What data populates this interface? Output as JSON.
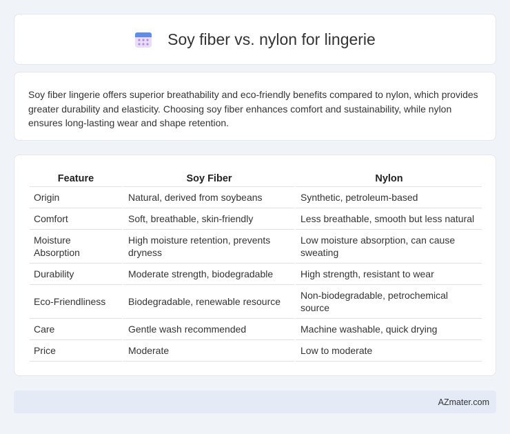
{
  "header": {
    "title": "Soy fiber vs. nylon for lingerie",
    "icon": "calendar-icon",
    "icon_colors": {
      "top": "#5b8def",
      "body": "#e9ddf7",
      "dots": "#b48cde"
    }
  },
  "intro": {
    "text": "Soy fiber lingerie offers superior breathability and eco-friendly benefits compared to nylon, which provides greater durability and elasticity. Choosing soy fiber enhances comfort and sustainability, while nylon ensures long-lasting wear and shape retention."
  },
  "table": {
    "headers": [
      "Feature",
      "Soy Fiber",
      "Nylon"
    ],
    "rows": [
      [
        "Origin",
        "Natural, derived from soybeans",
        "Synthetic, petroleum-based"
      ],
      [
        "Comfort",
        "Soft, breathable, skin-friendly",
        "Less breathable, smooth but less natural"
      ],
      [
        "Moisture Absorption",
        "High moisture retention, prevents dryness",
        "Low moisture absorption, can cause sweating"
      ],
      [
        "Durability",
        "Moderate strength, biodegradable",
        "High strength, resistant to wear"
      ],
      [
        "Eco-Friendliness",
        "Biodegradable, renewable resource",
        "Non-biodegradable, petrochemical source"
      ],
      [
        "Care",
        "Gentle wash recommended",
        "Machine washable, quick drying"
      ],
      [
        "Price",
        "Moderate",
        "Low to moderate"
      ]
    ]
  },
  "footer": {
    "site": "AZmater.com"
  },
  "colors": {
    "page_bg": "#f0f3f8",
    "card_bg": "#ffffff",
    "footer_bg": "#e4ebf7",
    "row_border": "#dde1e8"
  }
}
